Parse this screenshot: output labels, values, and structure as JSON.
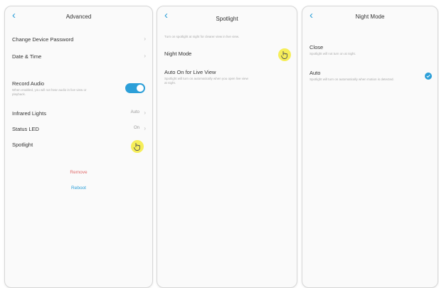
{
  "colors": {
    "accent": "#2c9fd8",
    "danger": "#e06a6a",
    "highlight": "#f5eb3c"
  },
  "screen1": {
    "title": "Advanced",
    "items": [
      {
        "label": "Change Device Password"
      },
      {
        "label": "Date & Time"
      },
      {
        "label": "Record Audio",
        "sub": "When enabled, you will not hear audio in live view or playback."
      },
      {
        "label": "Infrared Lights",
        "value": "Auto"
      },
      {
        "label": "Status LED",
        "value": "On"
      },
      {
        "label": "Spotlight"
      }
    ],
    "remove_label": "Remove",
    "reboot_label": "Reboot"
  },
  "screen2": {
    "title": "Spotlight",
    "note": "Turn on spotlight at night for clearer view in live view.",
    "items": [
      {
        "label": "Night Mode"
      },
      {
        "label": "Auto On for Live View",
        "sub": "Spotlight will turn on automatically when you open live view at night."
      }
    ]
  },
  "screen3": {
    "title": "Night Mode",
    "options": [
      {
        "label": "Close",
        "sub": "Spotlight will not turn on at night."
      },
      {
        "label": "Auto",
        "sub": "Spotlight will turn on automatically when motion is detected.",
        "selected": true
      }
    ]
  }
}
